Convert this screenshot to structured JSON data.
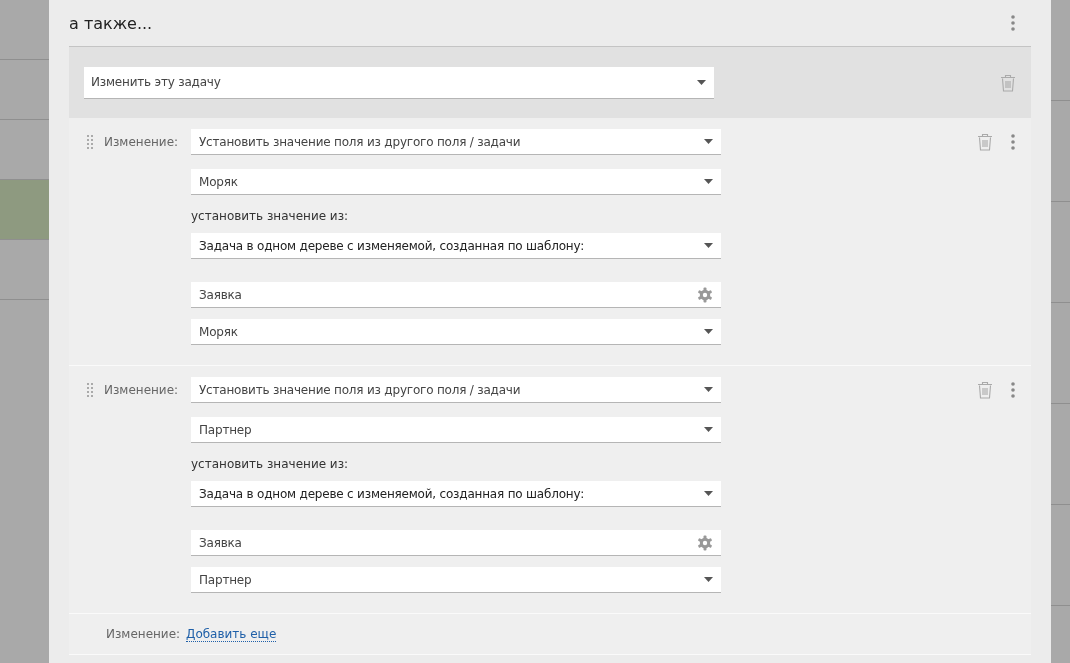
{
  "title": "а также...",
  "action": {
    "value": "Изменить эту задачу"
  },
  "changes": [
    {
      "label": "Изменение:",
      "operation": "Установить значение поля из другого поля / задачи",
      "field": "Моряк",
      "from_label": "установить значение из:",
      "source": "Задача в одном дереве с изменяемой, созданная по шаблону:",
      "template": "Заявка",
      "source_field": "Моряк"
    },
    {
      "label": "Изменение:",
      "operation": "Установить значение поля из другого поля / задачи",
      "field": "Партнер",
      "from_label": "установить значение из:",
      "source": "Задача в одном дереве с изменяемой, созданная по шаблону:",
      "template": "Заявка",
      "source_field": "Партнер"
    }
  ],
  "footer": {
    "label": "Изменение:",
    "link": "Добавить еще"
  }
}
